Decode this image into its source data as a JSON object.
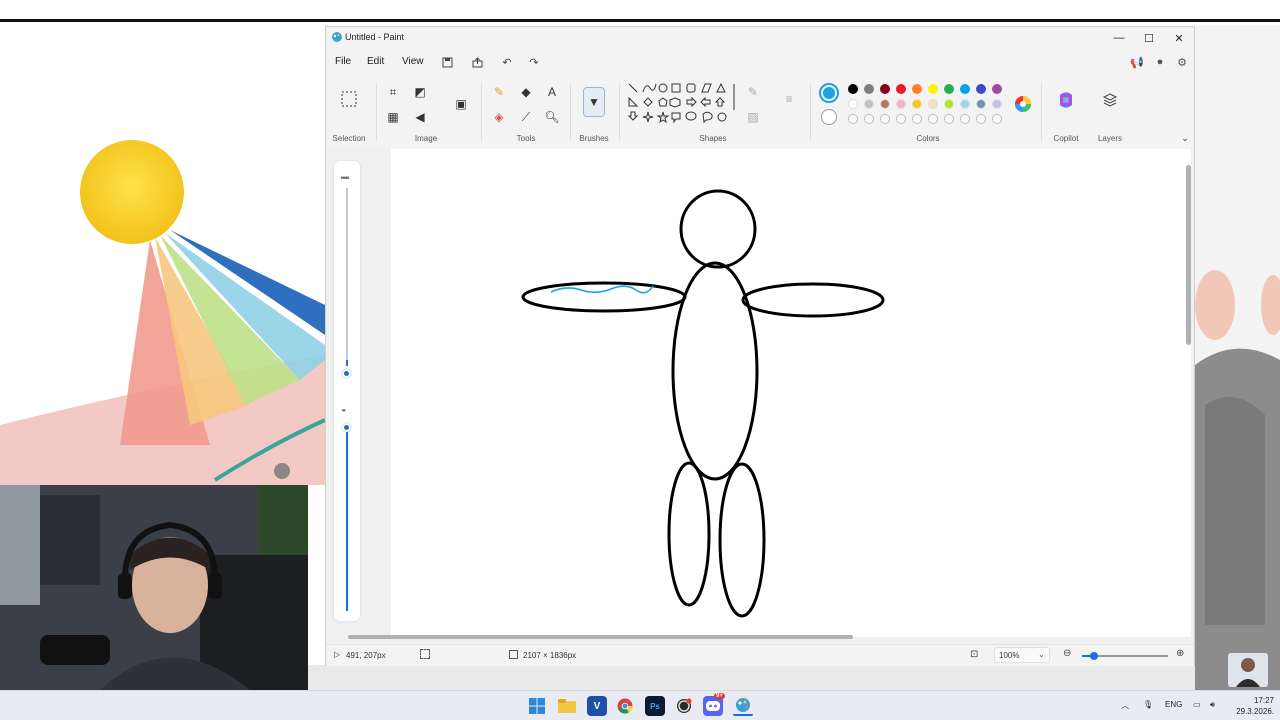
{
  "window": {
    "title": "Untitled - Paint",
    "controls": {
      "minimize": "—",
      "maximize": "☐",
      "close": "✕"
    }
  },
  "menu": {
    "items": [
      "File",
      "Edit",
      "View"
    ]
  },
  "ribbon": {
    "groups": {
      "selection": "Selection",
      "image": "Image",
      "tools": "Tools",
      "brushes": "Brushes",
      "shapes": "Shapes",
      "colors": "Colors",
      "copilot": "Copilot",
      "layers": "Layers"
    },
    "text_tool_glyph": "A",
    "primary_color": "#1aa3e0",
    "secondary_color": "#ffffff",
    "palette_row1": [
      "#000000",
      "#7f7f7f",
      "#880015",
      "#ed1c24",
      "#ff7f27",
      "#fff200",
      "#22b14c",
      "#00a2e8",
      "#3f48cc",
      "#a349a4"
    ],
    "palette_row2": [
      "#ffffff",
      "#c3c3c3",
      "#b97a57",
      "#ffaec9",
      "#ffc90e",
      "#efe4b0",
      "#b5e61d",
      "#99d9ea",
      "#7092be",
      "#c8bfe7"
    ]
  },
  "status": {
    "cursor_position": "491, 207px",
    "canvas_size": "2107 × 1836px",
    "zoom": "100%"
  },
  "drawing": {
    "outline_color": "#000000",
    "stroke_color": "#1aa3e0"
  },
  "taskbar": {
    "language": "ENG",
    "time": "17:27",
    "date": "29.3.2026.",
    "notification_badge": "9+"
  }
}
